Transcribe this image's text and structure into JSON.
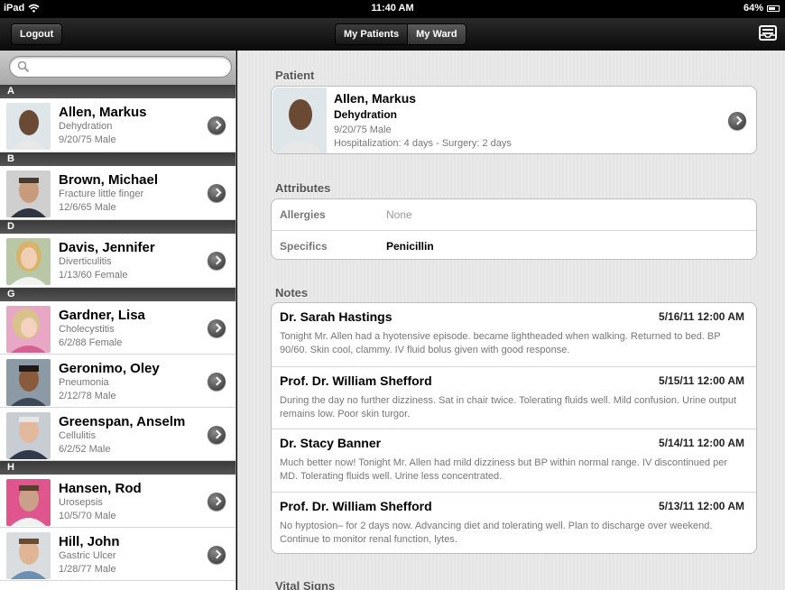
{
  "status_bar": {
    "device": "iPad",
    "time": "11:40 AM",
    "battery": "64%"
  },
  "nav": {
    "logout_label": "Logout",
    "tabs": [
      {
        "label": "My Patients",
        "active": false
      },
      {
        "label": "My Ward",
        "active": true
      }
    ],
    "tray_icon": "inbox-tray-icon"
  },
  "search": {
    "placeholder": "",
    "value": ""
  },
  "sections": [
    {
      "letter": "A",
      "patients": [
        {
          "name": "Allen, Markus",
          "diagnosis": "Dehydration",
          "meta": "9/20/75 Male"
        }
      ]
    },
    {
      "letter": "B",
      "patients": [
        {
          "name": "Brown, Michael",
          "diagnosis": "Fracture little finger",
          "meta": "12/6/65 Male"
        }
      ]
    },
    {
      "letter": "D",
      "patients": [
        {
          "name": "Davis, Jennifer",
          "diagnosis": "Diverticulitis",
          "meta": "1/13/60 Female"
        }
      ]
    },
    {
      "letter": "G",
      "patients": [
        {
          "name": "Gardner, Lisa",
          "diagnosis": "Cholecystitis",
          "meta": "6/2/88 Female"
        },
        {
          "name": "Geronimo, Oley",
          "diagnosis": "Pneumonia",
          "meta": "2/12/78 Male"
        },
        {
          "name": "Greenspan, Anselm",
          "diagnosis": "Cellulitis",
          "meta": "6/2/52 Male"
        }
      ]
    },
    {
      "letter": "H",
      "patients": [
        {
          "name": "Hansen, Rod",
          "diagnosis": "Urosepsis",
          "meta": "10/5/70 Male"
        },
        {
          "name": "Hill, John",
          "diagnosis": "Gastric Ulcer",
          "meta": "1/28/77 Male"
        }
      ]
    }
  ],
  "detail": {
    "patient_section": "Patient",
    "patient": {
      "name": "Allen, Markus",
      "diagnosis": "Dehydration",
      "meta": "9/20/75 Male",
      "hospitalization": "Hospitalization: 4 days - Surgery: 2 days"
    },
    "attributes_section": "Attributes",
    "attributes": [
      {
        "key": "Allergies",
        "value": "None",
        "strong": false
      },
      {
        "key": "Specifics",
        "value": "Penicillin",
        "strong": true
      }
    ],
    "notes_section": "Notes",
    "notes": [
      {
        "author": "Dr. Sarah Hastings",
        "date": "5/16/11 12:00 AM",
        "text": "Tonight Mr. Allen had a hyotensive episode. became lightheaded when walking. Returned to bed. BP 90/60. Skin cool, clammy. IV fluid bolus given with good response."
      },
      {
        "author": "Prof. Dr. William Shefford",
        "date": "5/15/11 12:00 AM",
        "text": "During the day no further dizziness. Sat in chair twice. Tolerating fluids well. Mild confusion. Urine output remains low. Poor skin turgor."
      },
      {
        "author": "Dr. Stacy Banner",
        "date": "5/14/11 12:00 AM",
        "text": "Much better now! Tonight Mr. Allen had mild dizziness but BP within normal range. IV discontinued per MD. Tolerating fluids well. Urine less concentrated."
      },
      {
        "author": "Prof. Dr. William Shefford",
        "date": "5/13/11 12:00 AM",
        "text": "No hyptosion– for 2 days now. Advancing diet and tolerating well. Plan to discharge over weekend. Continue to monitor renal function, lytes."
      }
    ],
    "vitals_section": "Vital Signs"
  },
  "colors": {
    "nav_bg": "#1a1a1a",
    "section_header": "#474747",
    "detail_bg": "#e9e9e9"
  }
}
